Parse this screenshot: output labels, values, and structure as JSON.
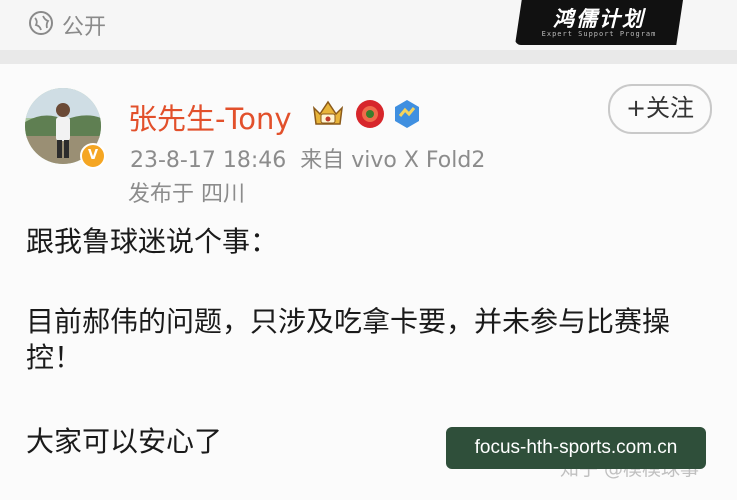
{
  "header": {
    "visibility_label": "公开",
    "visibility_icon": "globe-icon",
    "banner_title": "鸿儒计划",
    "banner_subtitle": "Expert Support Program"
  },
  "post": {
    "author": {
      "name": "张先生-Tony",
      "avatar_icon": "user-avatar",
      "verified_badge": "V",
      "badges": [
        "crown-vip-icon",
        "red-flower-icon",
        "blue-medal-icon"
      ]
    },
    "timestamp": "23-8-17 18:46",
    "source": "来自 vivo X Fold2",
    "location": "发布于 四川",
    "follow_label": "+关注",
    "content": {
      "line1": "跟我鲁球迷说个事：",
      "line2": "目前郝伟的问题，只涉及吃拿卡要，并未参与比赛操控！",
      "line3": "大家可以安心了"
    }
  },
  "watermarks": {
    "zhihu": "知乎 @模模球事",
    "url": "focus-hth-sports.com.cn"
  },
  "colors": {
    "username": "#e2502b",
    "meta": "#8c8c8c",
    "url_box": "#2f4f3a"
  }
}
